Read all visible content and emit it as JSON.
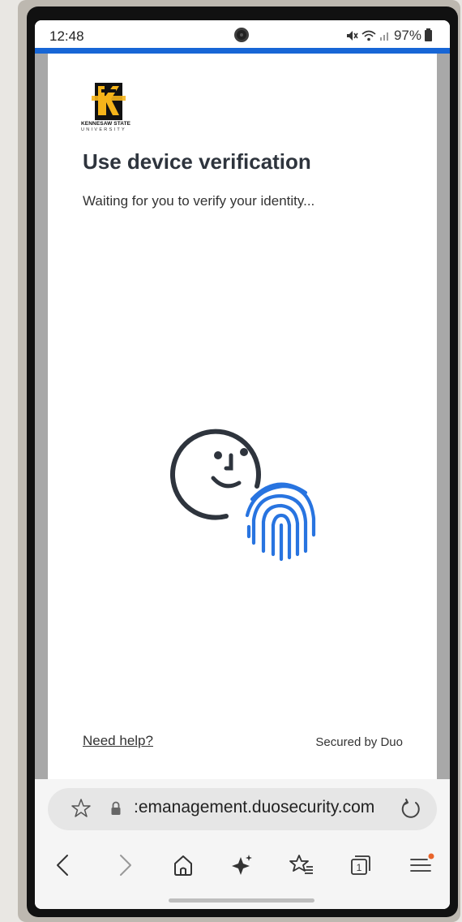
{
  "status_bar": {
    "time": "12:48",
    "battery": "97%",
    "icons": [
      "mute-icon",
      "wifi-icon",
      "signal-icon",
      "battery-icon"
    ]
  },
  "logo": {
    "name": "KENNESAW STATE",
    "sub": "UNIVERSITY",
    "color": "#f5b41a"
  },
  "main": {
    "title": "Use device verification",
    "subtitle": "Waiting for you to verify your identity...",
    "illustration": "face-fingerprint-icon",
    "help_link": "Need help?",
    "secured_by": "Secured by Duo"
  },
  "browser": {
    "url": ":emanagement.duosecurity.com",
    "nav": [
      "back-icon",
      "forward-icon",
      "home-icon",
      "assistant-icon",
      "bookmarks-icon",
      "tabs-icon",
      "menu-icon"
    ],
    "tab_count": "1"
  },
  "colors": {
    "accent": "#1766d6",
    "fingerprint": "#2874e0",
    "face": "#2e343d",
    "notification_dot": "#e8642a"
  }
}
